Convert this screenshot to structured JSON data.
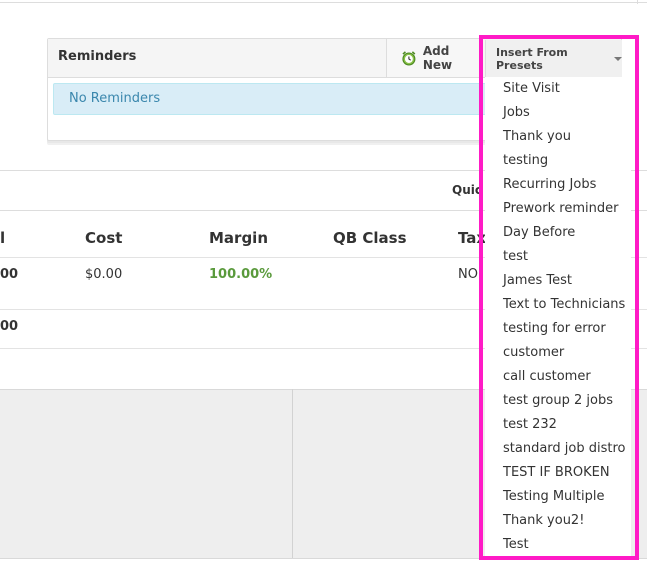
{
  "reminders": {
    "title": "Reminders",
    "add_new_label": "Add New",
    "empty_message": "No Reminders"
  },
  "presets": {
    "toggle_label": "Insert From Presets",
    "items": [
      "Site Visit",
      "Jobs",
      "Thank you",
      "testing",
      "Recurring Jobs",
      "Prework reminder",
      "Day Before",
      "test",
      "James Test",
      "Text to Technicians",
      "testing for error",
      "customer",
      "call customer",
      "test group 2 jobs",
      "test 232",
      "standard job distro",
      "TEST IF BROKEN",
      "Testing Multiple",
      "Thank you2!",
      "Test"
    ]
  },
  "quick_label": "Quic",
  "table": {
    "headers": {
      "total_partial": "l",
      "cost": "Cost",
      "margin": "Margin",
      "qb_class": "QB Class",
      "tax_partial": "Tax"
    },
    "row": {
      "total_partial": "00",
      "cost": "$0.00",
      "margin": "100.00%",
      "tax_partial": "NO"
    },
    "footer_total_partial": "00"
  },
  "colors": {
    "highlight": "#ff1ac6",
    "info_bg": "#d9edf7",
    "info_text": "#3a87ad",
    "margin_green": "#5a9a3c"
  }
}
